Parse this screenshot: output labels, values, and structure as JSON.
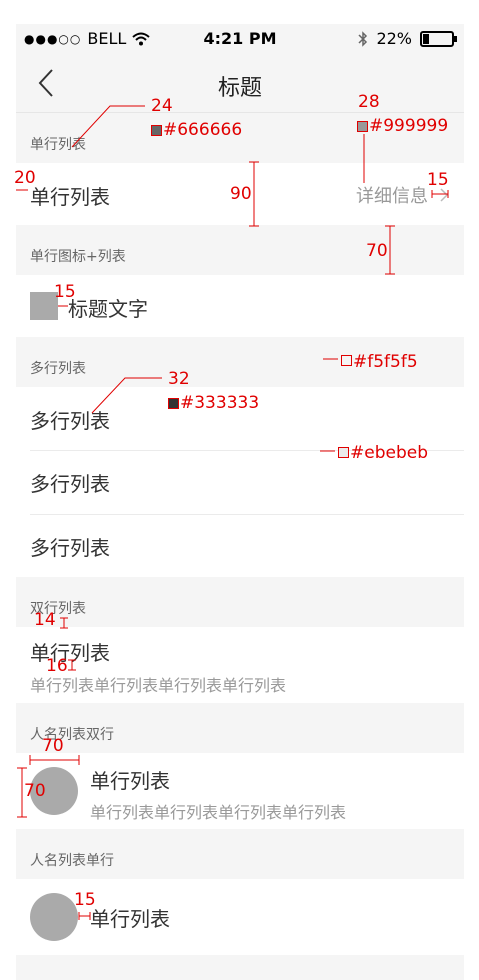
{
  "statusbar": {
    "carrier": "BELL",
    "time": "4:21 PM",
    "battery": "22%",
    "battery_level": 0.22,
    "signal_dots": "●●●○○"
  },
  "navbar": {
    "title": "标题"
  },
  "sections": {
    "s1": {
      "title": "单行列表",
      "row_label": "单行列表",
      "row_detail": "详细信息"
    },
    "s2": {
      "title": "单行图标+列表",
      "row_label": "标题文字"
    },
    "s3": {
      "title": "多行列表",
      "rows": [
        "多行列表",
        "多行列表",
        "多行列表"
      ]
    },
    "s4": {
      "title": "双行列表",
      "row_label": "单行列表",
      "row_sub": "单行列表单行列表单行列表单行列表"
    },
    "s5": {
      "title": "人名列表双行",
      "row_label": "单行列表",
      "row_sub": "单行列表单行列表单行列表单行列表"
    },
    "s6": {
      "title": "人名列表单行",
      "row_label": "单行列表"
    }
  },
  "annotations": {
    "n24": "24",
    "c666": "#666666",
    "n28": "28",
    "c999": "#999999",
    "n20": "20",
    "n90": "90",
    "n15a": "15",
    "n70a": "70",
    "n15b": "15",
    "cf5": "#f5f5f5",
    "n32": "32",
    "c333": "#333333",
    "ceb": "#ebebeb",
    "n14": "14",
    "n16": "16",
    "n70b": "70",
    "n70c": "70",
    "n15c": "15"
  },
  "colors": {
    "accent": "#e00000",
    "bg": "#f5f5f5",
    "divider": "#ebebeb",
    "text": "#333333",
    "secondary": "#999999",
    "section": "#666666",
    "placeholder": "#aaaaaa"
  }
}
